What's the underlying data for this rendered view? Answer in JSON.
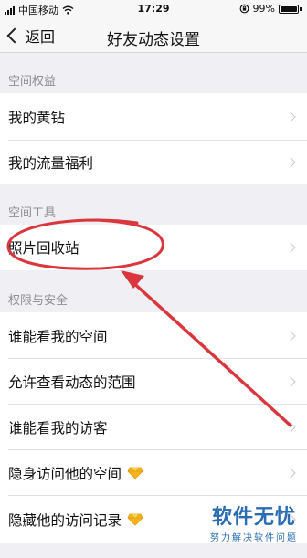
{
  "status_bar": {
    "carrier": "中国移动",
    "time": "17:29",
    "battery_percent": "99%",
    "battery_level": 0.99
  },
  "nav": {
    "back_label": "返回",
    "title": "好友动态设置"
  },
  "sections": [
    {
      "header": "空间权益",
      "rows": [
        {
          "label": "我的黄钻",
          "icon": "chevron-right-icon"
        },
        {
          "label": "我的流量福利",
          "icon": "chevron-right-icon"
        }
      ]
    },
    {
      "header": "空间工具",
      "rows": [
        {
          "label": "照片回收站",
          "icon": "chevron-right-icon"
        }
      ]
    },
    {
      "header": "权限与安全",
      "rows": [
        {
          "label": "谁能看我的空间",
          "icon": "chevron-right-icon"
        },
        {
          "label": "允许查看动态的范围",
          "icon": "chevron-right-icon"
        },
        {
          "label": "谁能看我的访客",
          "icon": "chevron-right-icon"
        },
        {
          "label": "隐身访问他的空间",
          "badge": "diamond-icon",
          "icon": "chevron-right-icon"
        },
        {
          "label": "隐藏他的访问记录",
          "badge": "diamond-icon",
          "icon": "chevron-right-icon"
        }
      ]
    }
  ],
  "annotation": {
    "color": "#d9373d",
    "circled_item": "照片回收站",
    "arrow": "pointing to circled item"
  },
  "watermark": {
    "title": "软件无忧",
    "subtitle": "努力解决软件问题",
    "color": "#2a6db5"
  },
  "colors": {
    "background": "#efeff4",
    "row_background": "#ffffff",
    "section_header_text": "#8e8e93",
    "chevron": "#c7c7cc",
    "diamond_badge": "#f5b51a"
  }
}
